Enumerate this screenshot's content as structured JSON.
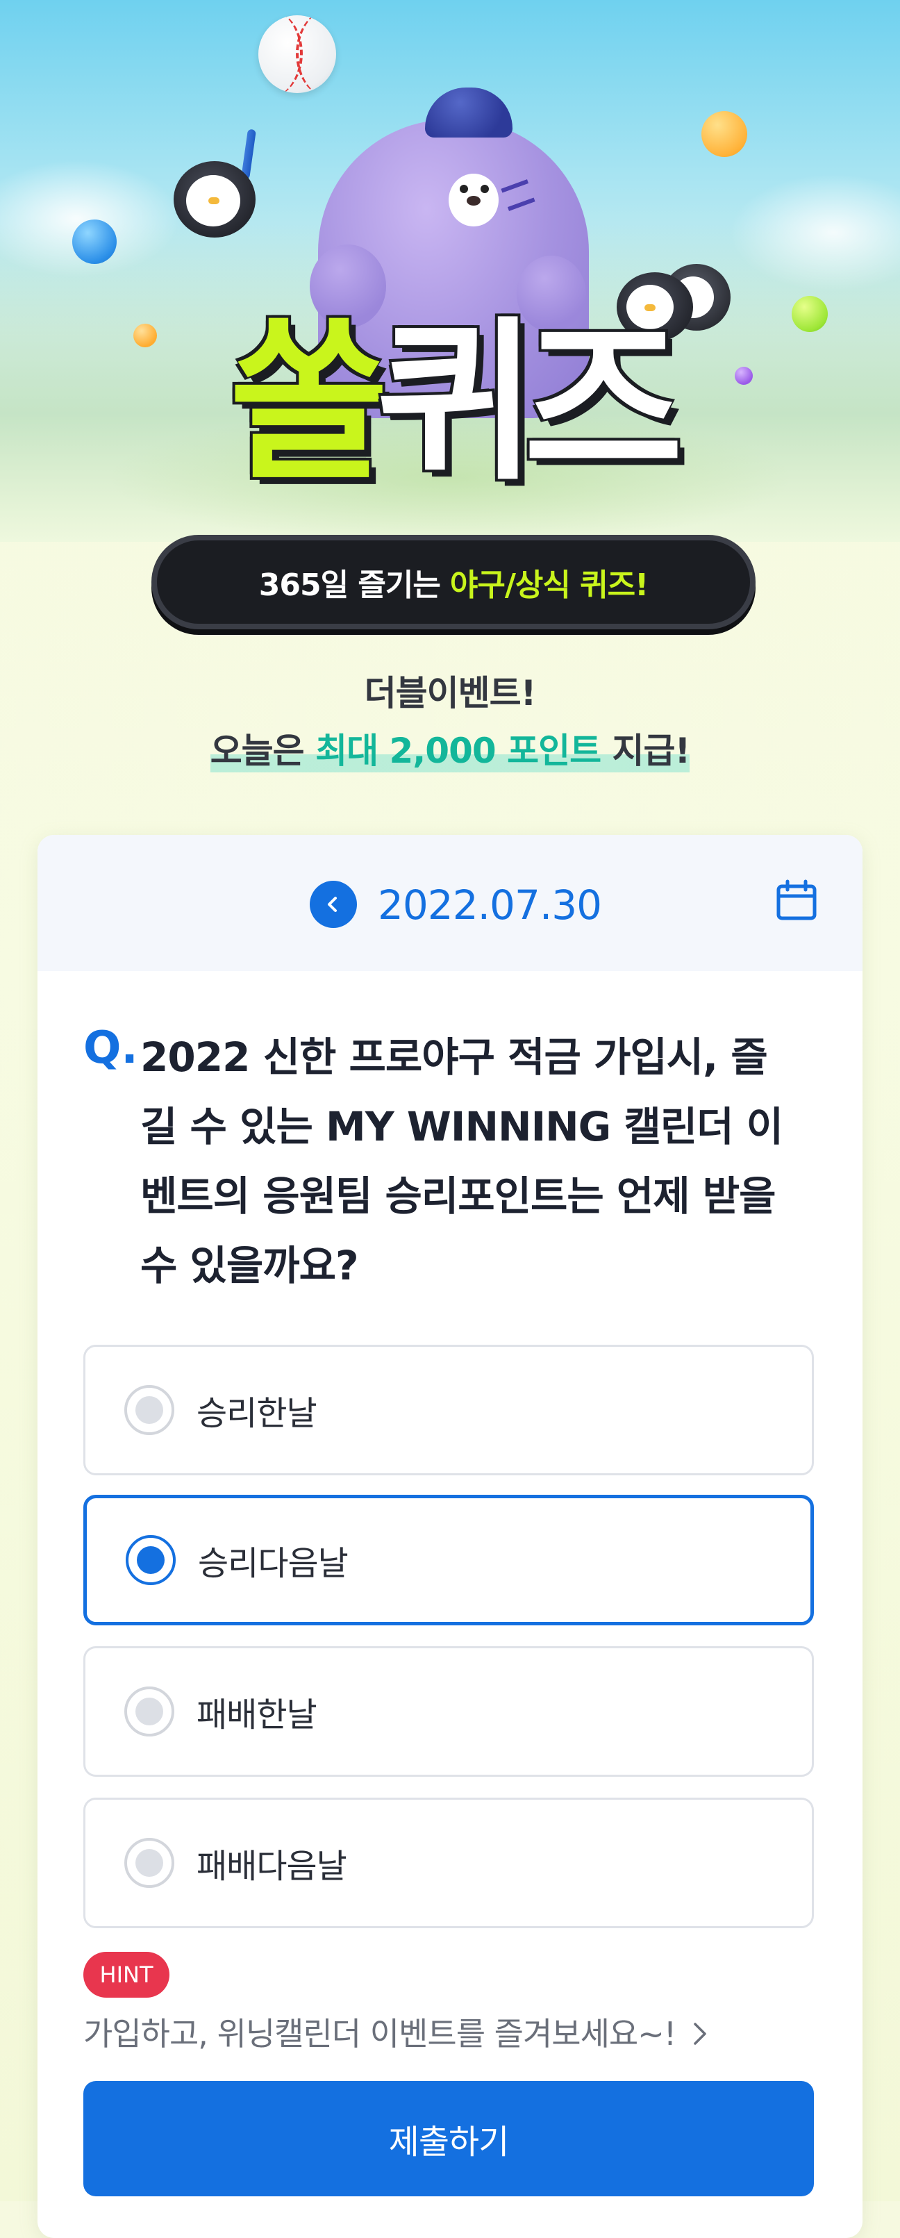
{
  "hero": {
    "logo_chars": [
      "쏠",
      "퀴",
      "즈"
    ],
    "tagline_prefix": "365일 즐기는",
    "tagline_highlight": "야구/상식 퀴즈!"
  },
  "event": {
    "line1": "더블이벤트!",
    "line2_prefix": "오늘은",
    "line2_highlight": "최대 2,000 포인트",
    "line2_suffix": "지급!"
  },
  "date_nav": {
    "date": "2022.07.30",
    "prev_icon": "chevron-left-icon",
    "calendar_icon": "calendar-icon"
  },
  "quiz": {
    "q_mark": "Q.",
    "question_lines": [
      "2022 신한 프로야구 적금 가입시, 즐",
      "길 수 있는 MY WINNING 캘린더 이",
      "벤트의 응원팀 승리포인트는 언제 받을",
      "수 있을까요?"
    ],
    "options": [
      {
        "label": "승리한날",
        "selected": false
      },
      {
        "label": "승리다음날",
        "selected": true
      },
      {
        "label": "패배한날",
        "selected": false
      },
      {
        "label": "패배다음날",
        "selected": false
      }
    ],
    "selected_index": 1
  },
  "hint": {
    "badge": "HINT",
    "text": "가입하고, 위닝캘린더 이벤트를 즐겨보세요~!"
  },
  "submit_label": "제출하기",
  "colors": {
    "primary": "#1470e0",
    "accent_lime": "#c9f51c",
    "teal": "#13b69a",
    "hint_red": "#e8364e",
    "dark": "#1b1d22"
  }
}
